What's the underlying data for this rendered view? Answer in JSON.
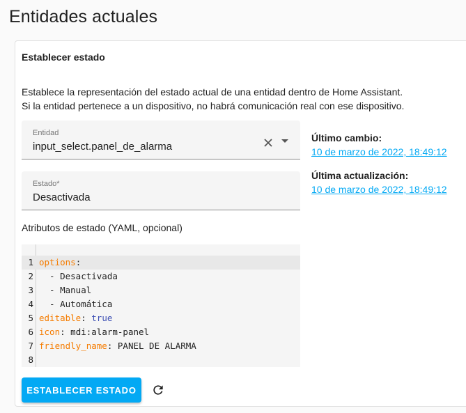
{
  "page": {
    "title": "Entidades actuales"
  },
  "card": {
    "title": "Establecer estado",
    "description_line1": "Establece la representación del estado actual de una entidad dentro de Home Assistant.",
    "description_line2": "Si la entidad pertenece a un dispositivo, no habrá comunicación real con ese dispositivo."
  },
  "entity_field": {
    "label": "Entidad",
    "value": "input_select.panel_de_alarma",
    "clear_icon": "close-icon",
    "dropdown_icon": "menu-down-icon"
  },
  "state_field": {
    "label": "Estado*",
    "value": "Desactivada"
  },
  "attributes": {
    "label": "Atributos de estado (YAML, opcional)",
    "lines": [
      {
        "num": "1",
        "key": "options",
        "sep": ":",
        "rest": "",
        "bool": ""
      },
      {
        "num": "2",
        "key": "",
        "sep": "",
        "rest": "  - Desactivada",
        "bool": ""
      },
      {
        "num": "3",
        "key": "",
        "sep": "",
        "rest": "  - Manual",
        "bool": ""
      },
      {
        "num": "4",
        "key": "",
        "sep": "",
        "rest": "  - Automática",
        "bool": ""
      },
      {
        "num": "5",
        "key": "editable",
        "sep": ": ",
        "rest": "",
        "bool": "true"
      },
      {
        "num": "6",
        "key": "icon",
        "sep": ": ",
        "rest": "mdi:alarm-panel",
        "bool": ""
      },
      {
        "num": "7",
        "key": "friendly_name",
        "sep": ": ",
        "rest": "PANEL DE ALARMA",
        "bool": ""
      },
      {
        "num": "8",
        "key": "",
        "sep": "",
        "rest": "",
        "bool": ""
      }
    ],
    "active_line": 1
  },
  "info": {
    "last_changed_label": "Último cambio:",
    "last_changed_value": "10 de marzo de 2022, 18:49:12",
    "last_updated_label": "Última actualización:",
    "last_updated_value": "10 de marzo de 2022, 18:49:12"
  },
  "actions": {
    "set_state_label": "ESTABLECER ESTADO",
    "refresh_icon": "refresh-icon"
  },
  "colors": {
    "accent": "#03a9f4",
    "yaml_key": "#f57c00",
    "yaml_bool": "#3f51b5"
  }
}
